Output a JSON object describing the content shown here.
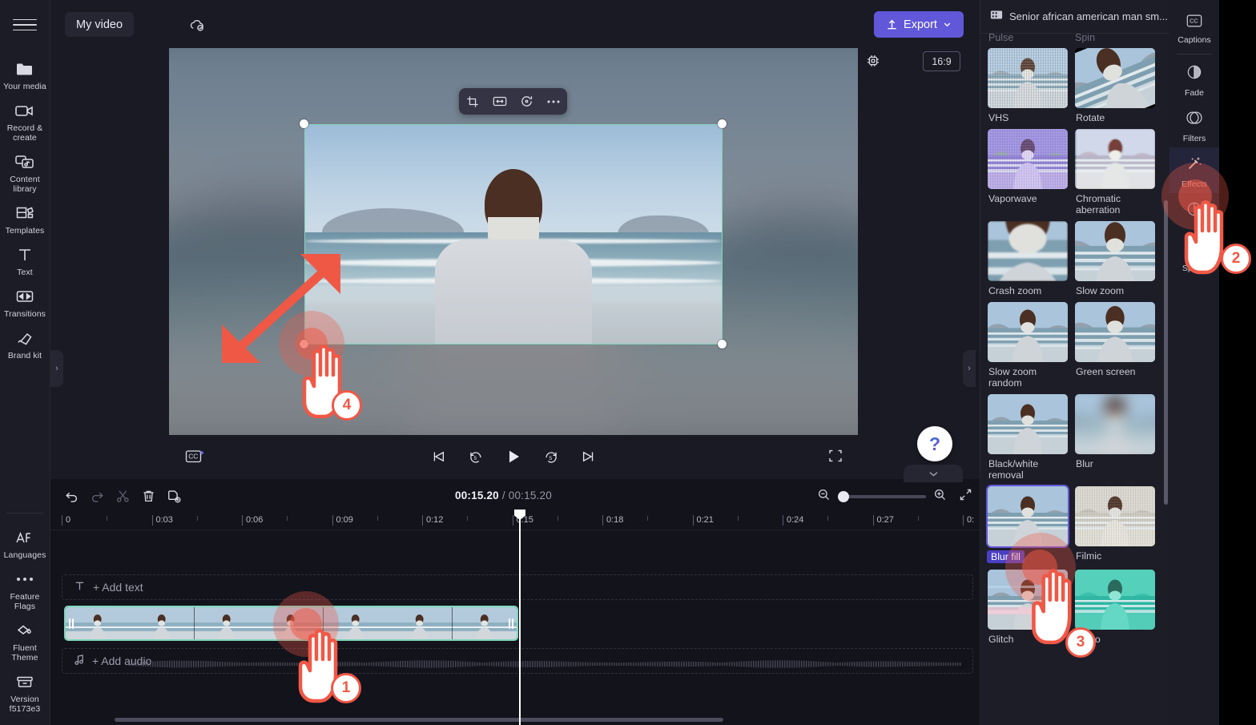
{
  "app": {
    "project_name": "My video",
    "cloud_status_icon": "cloud-saved-icon",
    "export_label": "Export"
  },
  "left_rail": {
    "menu_icon": "hamburger-menu-icon",
    "items": [
      {
        "label": "Your media",
        "icon": "media-folder-icon"
      },
      {
        "label": "Record & create",
        "icon": "video-camera-icon"
      },
      {
        "label": "Content library",
        "icon": "content-library-icon"
      },
      {
        "label": "Templates",
        "icon": "templates-icon"
      },
      {
        "label": "Text",
        "icon": "text-icon"
      },
      {
        "label": "Transitions",
        "icon": "transitions-icon"
      },
      {
        "label": "Brand kit",
        "icon": "brand-kit-icon"
      }
    ],
    "bottom_items": [
      {
        "label": "Languages",
        "icon": "languages-icon"
      },
      {
        "label": "Feature Flags",
        "icon": "ellipsis-icon"
      },
      {
        "label": "Fluent Theme",
        "icon": "paint-bucket-icon"
      },
      {
        "label": "Version f5173e3",
        "icon": "archive-icon"
      }
    ]
  },
  "preview": {
    "float_toolbar": [
      {
        "icon": "crop-icon"
      },
      {
        "icon": "fit-width-icon"
      },
      {
        "icon": "rotate-icon"
      },
      {
        "icon": "more-options-icon"
      }
    ],
    "gear_icon": "render-settings-icon",
    "aspect_ratio": "16:9",
    "captions_button_icon": "cc-sparkle-icon",
    "transport": [
      {
        "icon": "skip-to-start-icon"
      },
      {
        "icon": "rewind-5s-icon"
      },
      {
        "icon": "play-icon"
      },
      {
        "icon": "forward-5s-icon"
      },
      {
        "icon": "skip-to-end-icon"
      }
    ],
    "fullscreen_icon": "fullscreen-icon",
    "help_label": "?"
  },
  "timeline": {
    "tools": [
      {
        "icon": "undo-icon",
        "enabled": true
      },
      {
        "icon": "redo-icon",
        "enabled": false
      },
      {
        "icon": "split-scissors-icon",
        "enabled": false
      },
      {
        "icon": "delete-trash-icon",
        "enabled": true
      },
      {
        "icon": "duplicate-icon",
        "enabled": true
      }
    ],
    "current_time": "00:15.20",
    "separator": "/",
    "total_time": "00:15.20",
    "zoom_out_icon": "zoom-out-icon",
    "zoom_in_icon": "zoom-in-icon",
    "fit_icon": "fit-timeline-icon",
    "ruler_ticks": [
      "0",
      "0:03",
      "0:06",
      "0:09",
      "0:12",
      "0:15",
      "0:18",
      "0:21",
      "0:24",
      "0:27",
      "0:"
    ],
    "add_text_label": "+ Add text",
    "add_text_icon": "text-t-icon",
    "add_audio_label": "+ Add audio",
    "add_audio_icon": "music-note-icon"
  },
  "effects_panel": {
    "header_title": "Senior african american man sm...",
    "header_icon": "film-strip-icon",
    "cut_off_row": [
      "Pulse",
      "Spin"
    ],
    "effects": [
      {
        "name": "VHS",
        "selected": false
      },
      {
        "name": "Rotate",
        "selected": false
      },
      {
        "name": "Vaporwave",
        "selected": false
      },
      {
        "name": "Chromatic aberration",
        "selected": false
      },
      {
        "name": "Crash zoom",
        "selected": false
      },
      {
        "name": "Slow zoom",
        "selected": false
      },
      {
        "name": "Slow zoom random",
        "selected": false
      },
      {
        "name": "Green screen",
        "selected": false
      },
      {
        "name": "Black/white removal",
        "selected": false
      },
      {
        "name": "Blur",
        "selected": false
      },
      {
        "name": "Blur fill",
        "selected": true
      },
      {
        "name": "Filmic",
        "selected": false
      },
      {
        "name": "Glitch",
        "selected": false
      },
      {
        "name": "Disco",
        "selected": false
      }
    ]
  },
  "right_rail": {
    "items": [
      {
        "label": "Captions",
        "icon": "cc-icon",
        "active": false
      },
      {
        "label": "Fade",
        "icon": "fade-icon",
        "active": false
      },
      {
        "label": "Filters",
        "icon": "filters-icon",
        "active": false
      },
      {
        "label": "Effects",
        "icon": "magic-wand-icon",
        "active": true
      },
      {
        "label": "Speed",
        "icon": "speedometer-icon",
        "active": false
      }
    ]
  },
  "annotations": {
    "steps": [
      "1",
      "2",
      "3",
      "4"
    ],
    "accent_color": "#f05846"
  },
  "colors": {
    "accent": "#6157d9",
    "selection": "#7fd6b8",
    "panel_bg": "#1d1d27",
    "app_bg": "#1a1a24"
  }
}
